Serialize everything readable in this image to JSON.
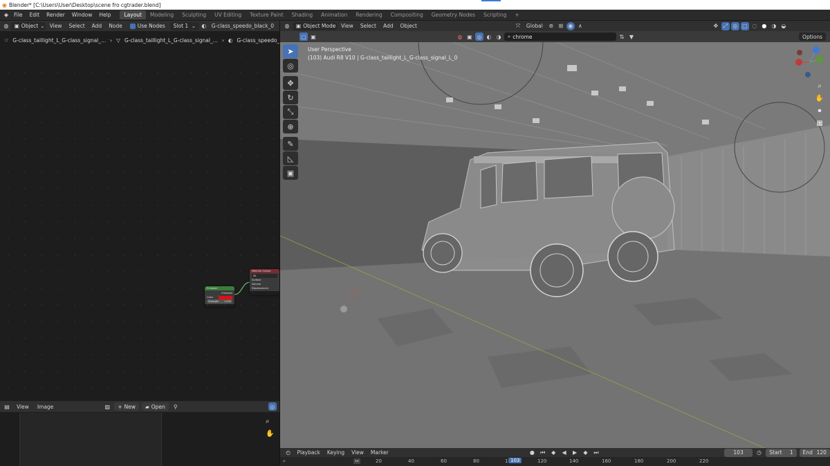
{
  "window": {
    "title": "Blender* [C:\\Users\\User\\Desktop\\scene fro cgtrader.blend]"
  },
  "topbar": {
    "menus": [
      "File",
      "Edit",
      "Render",
      "Window",
      "Help"
    ],
    "workspaces": [
      "Layout",
      "Modeling",
      "Sculpting",
      "UV Editing",
      "Texture Paint",
      "Shading",
      "Animation",
      "Rendering",
      "Compositing",
      "Geometry Nodes",
      "Scripting"
    ],
    "active_workspace": "Layout",
    "add_tab": "+"
  },
  "node_editor": {
    "object_mode": "Object",
    "menus": [
      "View",
      "Select",
      "Add",
      "Node"
    ],
    "use_nodes_label": "Use Nodes",
    "slot": "Slot 1",
    "material": "G-class_speedo_black_0",
    "breadcrumbs": [
      "G-class_taillight_L_G-class_signal_...",
      "G-class_taillight_L_G-class_signal_...",
      "G-class_speedo_black_0.0..."
    ],
    "emission_node": {
      "title": "Emission",
      "out": "Emission",
      "color_label": "Color",
      "strength_label": "Strength",
      "strength_value": "1.000"
    },
    "output_node": {
      "title": "Material Output",
      "target": "All",
      "surface": "Surface",
      "volume": "Volume",
      "displacement": "Displacement"
    }
  },
  "image_editor": {
    "menus": [
      "View",
      "Image"
    ],
    "new_label": "New",
    "open_label": "Open"
  },
  "viewport": {
    "mode": "Object Mode",
    "menus": [
      "View",
      "Select",
      "Add",
      "Object"
    ],
    "orientation": "Global",
    "search_value": "chrome",
    "options_label": "Options",
    "perspective_label": "User Perspective",
    "object_info": "(103) Audi R8 V10 | G-class_taillight_L_G-class_signal_L_0"
  },
  "timeline": {
    "menus": [
      "Playback",
      "Keying",
      "View",
      "Marker"
    ],
    "current_frame": "103",
    "start_label": "Start",
    "start_value": "1",
    "end_label": "End",
    "end_value": "120",
    "ruler_ticks": [
      "20",
      "40",
      "60",
      "80",
      "120",
      "140",
      "160",
      "180",
      "200",
      "220"
    ],
    "ruler_partial": "1",
    "playhead": "103"
  },
  "colors": {
    "accent": "#4772b3",
    "emission_header": "#3a7d3a",
    "output_header": "#7a2a30",
    "emission_color": "#e01010"
  }
}
